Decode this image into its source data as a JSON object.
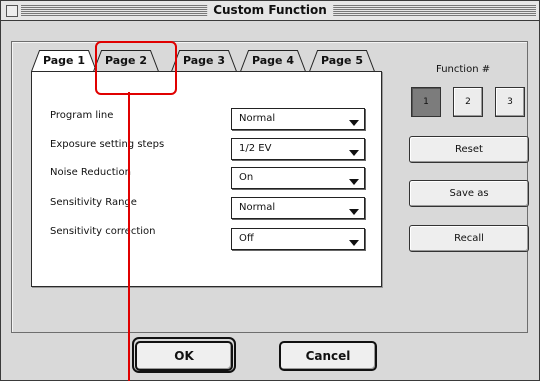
{
  "window": {
    "title": "Custom Function"
  },
  "tabs": [
    {
      "label": "Page 1",
      "selected": true
    },
    {
      "label": "Page 2",
      "selected": false
    },
    {
      "label": "Page 3",
      "selected": false
    },
    {
      "label": "Page 4",
      "selected": false
    },
    {
      "label": "Page 5",
      "selected": false
    }
  ],
  "settings": [
    {
      "label": "Program line",
      "value": "Normal"
    },
    {
      "label": "Exposure setting steps",
      "value": "1/2 EV"
    },
    {
      "label": "Noise Reduction",
      "value": "On"
    },
    {
      "label": "Sensitivity Range",
      "value": "Normal"
    },
    {
      "label": "Sensitivity correction",
      "value": "Off"
    }
  ],
  "function": {
    "label": "Function #",
    "buttons": [
      {
        "label": "1",
        "selected": true
      },
      {
        "label": "2",
        "selected": false
      },
      {
        "label": "3",
        "selected": false
      }
    ]
  },
  "side_buttons": {
    "reset": "Reset",
    "save_as": "Save as",
    "recall": "Recall"
  },
  "footer": {
    "ok": "OK",
    "cancel": "Cancel"
  },
  "colors": {
    "callout": "#e00000",
    "selected_function": "#7c7c7c"
  }
}
